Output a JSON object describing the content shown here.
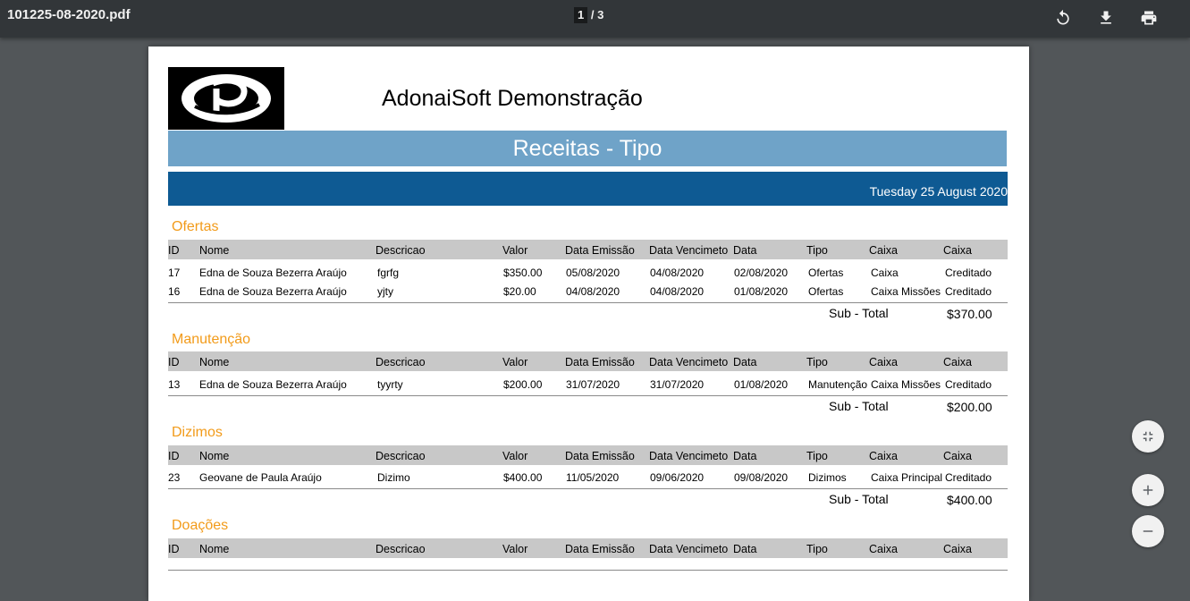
{
  "viewer": {
    "file_name": "101225-08-2020.pdf",
    "page_current": "1",
    "page_total": "/ 3",
    "icons": [
      "rotate-icon",
      "download-icon",
      "print-icon",
      "fit-page-icon",
      "zoom-in-icon",
      "zoom-out-icon"
    ]
  },
  "report": {
    "company": "AdonaiSoft Demonstração",
    "title": "Receitas - Tipo",
    "date": "Tuesday 25 August 2020",
    "columns": [
      "ID",
      "Nome",
      "Descricao",
      "Valor",
      "Data Emissão",
      "Data Vencimeto",
      "Data",
      "Tipo",
      "Caixa",
      "Caixa"
    ],
    "subtotal_label": "Sub - Total",
    "sections": [
      {
        "name": "Ofertas",
        "rows": [
          [
            "17",
            "Edna de Souza Bezerra Araújo",
            "fgrfg",
            "$350.00",
            "05/08/2020",
            "04/08/2020",
            "02/08/2020",
            "Ofertas",
            "Caixa",
            "Creditado"
          ],
          [
            "16",
            "Edna de Souza Bezerra Araújo",
            "yjty",
            "$20.00",
            "04/08/2020",
            "04/08/2020",
            "01/08/2020",
            "Ofertas",
            "Caixa Missões",
            "Creditado"
          ]
        ],
        "subtotal": "$370.00"
      },
      {
        "name": "Manutenção",
        "rows": [
          [
            "13",
            "Edna de Souza Bezerra Araújo",
            "tyyrty",
            "$200.00",
            "31/07/2020",
            "31/07/2020",
            "01/08/2020",
            "Manutenção",
            "Caixa Missões",
            "Creditado"
          ]
        ],
        "subtotal": "$200.00"
      },
      {
        "name": "Dizimos",
        "rows": [
          [
            "23",
            "Geovane de Paula Araújo",
            "Dizimo",
            "$400.00",
            "11/05/2020",
            "09/06/2020",
            "09/08/2020",
            "Dizimos",
            "Caixa Principal",
            "Creditado"
          ]
        ],
        "subtotal": "$400.00"
      },
      {
        "name": "Doações",
        "rows": [],
        "subtotal": ""
      }
    ]
  }
}
